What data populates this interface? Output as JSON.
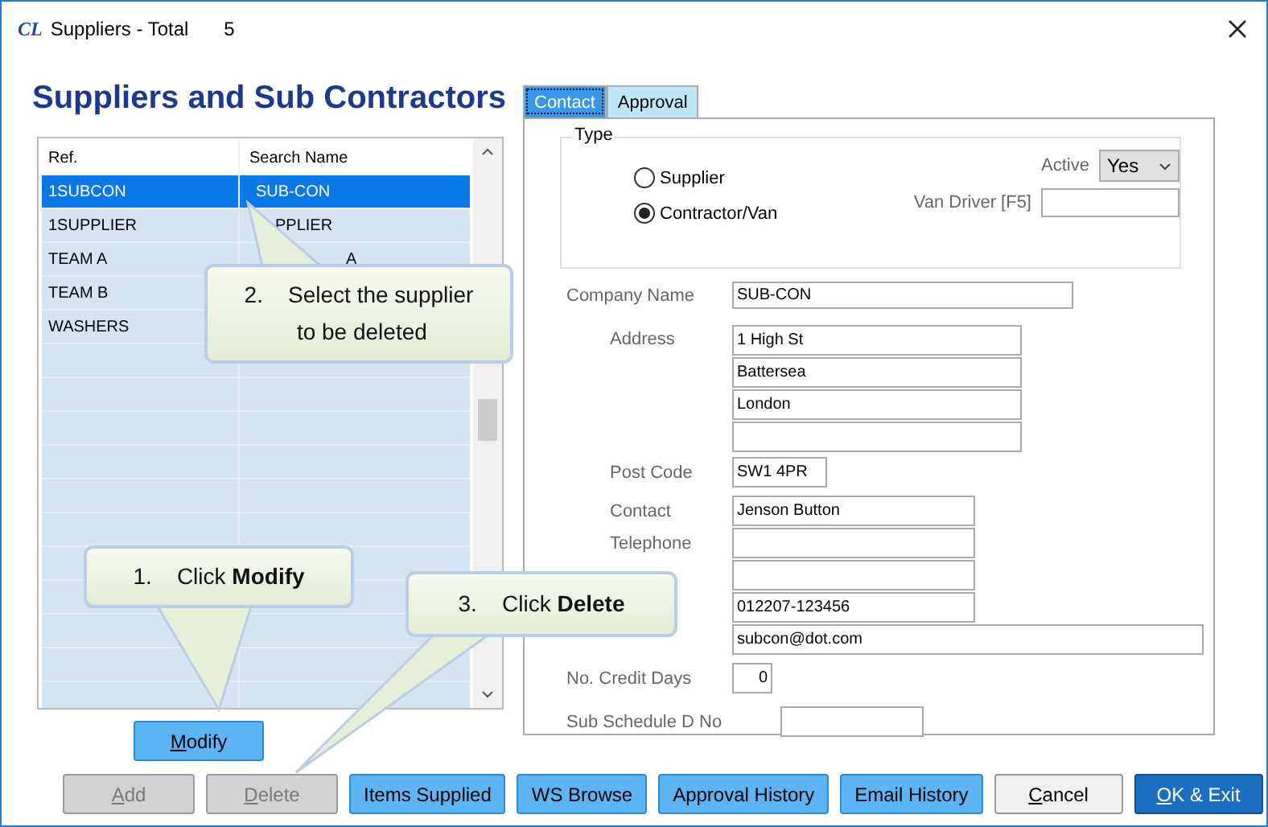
{
  "window": {
    "logo": "CL",
    "title": "Suppliers - Total",
    "count": "5"
  },
  "heading": "Suppliers and Sub Contractors",
  "list": {
    "columns": [
      "Ref.",
      "Search Name"
    ],
    "rows": [
      {
        "ref": "1SUBCON",
        "search_name": "SUB-CON",
        "selected": true
      },
      {
        "ref": "1SUPPLIER",
        "search_name": "PPLIER",
        "selected": false
      },
      {
        "ref": "TEAM A",
        "search_name": "A",
        "selected": false
      },
      {
        "ref": "TEAM B",
        "search_name": "",
        "selected": false
      },
      {
        "ref": "WASHERS",
        "search_name": "",
        "selected": false
      }
    ]
  },
  "tabs": [
    {
      "label": "Contact",
      "selected": true
    },
    {
      "label": "Approval",
      "selected": false
    }
  ],
  "type_group": {
    "title": "Type",
    "options": [
      {
        "label": "Supplier",
        "checked": false
      },
      {
        "label": "Contractor/Van",
        "checked": true
      }
    ],
    "active": {
      "label": "Active",
      "value": "Yes"
    },
    "van_driver": {
      "label": "Van Driver [F5]"
    }
  },
  "form": {
    "company_name": {
      "label": "Company Name",
      "value": "SUB-CON"
    },
    "address": {
      "label": "Address",
      "lines": [
        "1 High St",
        "Battersea",
        "London"
      ]
    },
    "post_code": {
      "label": "Post  Code",
      "value": "SW1 4PR"
    },
    "contacts": [
      {
        "label": "Contact",
        "value": "Jenson Button",
        "wide": false
      },
      {
        "label": "Telephone",
        "wide": false
      },
      {
        "wide": false
      },
      {
        "value": "012207-123456",
        "wide": false
      },
      {
        "value": "subcon@dot.com",
        "wide": true
      }
    ],
    "credit_days": {
      "label": "No. Credit Days",
      "value": "0"
    },
    "sub_schedule": {
      "label": "Sub Schedule D No"
    }
  },
  "modify_button": {
    "key": "M",
    "rest": "odify",
    "kind": "action",
    "disabled": false
  },
  "buttons": [
    {
      "key": "A",
      "rest": "dd",
      "kind": "action",
      "disabled": true
    },
    {
      "key": "D",
      "rest": "elete",
      "kind": "action",
      "disabled": true
    },
    {
      "rest": "Items Supplied",
      "kind": "action",
      "disabled": false
    },
    {
      "rest": "WS Browse",
      "kind": "action",
      "disabled": false
    },
    {
      "rest": "Approval History",
      "kind": "action",
      "disabled": false
    },
    {
      "rest": "Email History",
      "kind": "action",
      "disabled": false
    },
    {
      "key": "C",
      "rest": "ancel",
      "kind": "cancel",
      "disabled": false
    },
    {
      "key": "O",
      "rest": "K & Exit",
      "kind": "default",
      "disabled": false
    }
  ],
  "callouts": [
    {
      "text": "2.    Select the supplier\n to be deleted"
    },
    {
      "text": "1.    Click **Modify**"
    },
    {
      "text": "3.    Click **Delete**"
    }
  ]
}
